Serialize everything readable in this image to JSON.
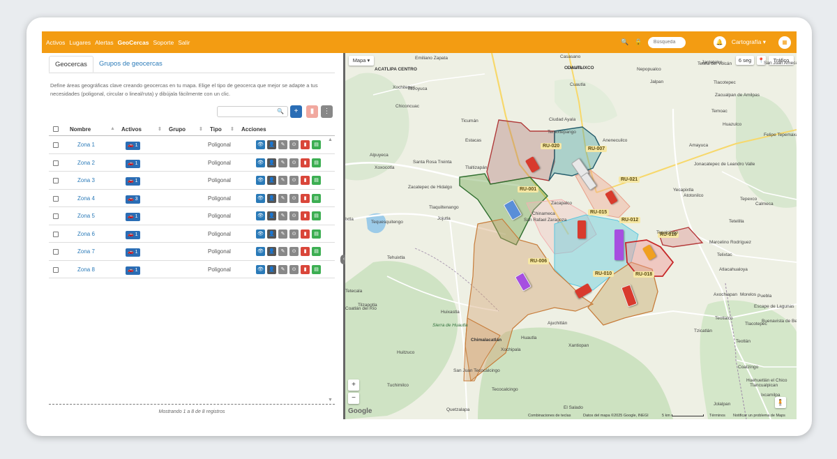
{
  "nav": [
    "Activos",
    "Lugares",
    "Alertas",
    "GeoCercas",
    "Soporte",
    "Salir"
  ],
  "topbar": {
    "search_placeholder": "Búsqueda",
    "user": "Cartografía",
    "user_caret": "▾",
    "search_icon": "🔍",
    "lock_icon": "🔒",
    "bell_icon": "🔔",
    "grid_icon": "▦"
  },
  "tabs": [
    "Geocercas",
    "Grupos de geocercas"
  ],
  "description": "Define áreas geográficas clave creando geocercas en tu mapa. Elige el tipo de geocerca que mejor se adapte a tus necesidades (poligonal, circular o lineal/ruta) y dibújala fácilmente con un clic.",
  "table": {
    "headers": [
      "Nombre",
      "Activos",
      "Grupo",
      "Tipo",
      "Acciones"
    ],
    "rows": [
      {
        "name": "Zona 1",
        "active": "1",
        "type": "Poligonal"
      },
      {
        "name": "Zona 2",
        "active": "1",
        "type": "Poligonal"
      },
      {
        "name": "Zona 3",
        "active": "1",
        "type": "Poligonal"
      },
      {
        "name": "Zona 4",
        "active": "3",
        "type": "Poligonal"
      },
      {
        "name": "Zona 5",
        "active": "1",
        "type": "Poligonal"
      },
      {
        "name": "Zona 6",
        "active": "1",
        "type": "Poligonal"
      },
      {
        "name": "Zona 7",
        "active": "1",
        "type": "Poligonal"
      },
      {
        "name": "Zona 8",
        "active": "1",
        "type": "Poligonal"
      }
    ],
    "footer": "Mostrando 1 a 8 de 8 registros"
  },
  "map": {
    "type_button": "Mapa ▾",
    "refresh": "6 seg",
    "traffic": "Tráfico",
    "pin_icon": "📍",
    "zoom_in": "+",
    "zoom_out": "−",
    "pegman_icon": "🧍",
    "google": "Google",
    "attribution": [
      "Combinaciones de teclas",
      "Datos del mapa ©2025 Google, INEGI",
      "5 km",
      "Términos",
      "Notificar un problema de Maps"
    ],
    "route_tags": [
      "RU-020",
      "RU-007",
      "RU-001",
      "RU-021",
      "RU-015",
      "RU-012",
      "RU-019",
      "RU-006",
      "RU-010",
      "RU-018"
    ],
    "places": [
      "Emiliano Zapata",
      "ACATLIPA CENTRO",
      "Xochitepec",
      "Tezoyuca",
      "Chiconcuac",
      "Casasano",
      "CUAUTLIXCO",
      "Cuautla",
      "Ciudad Ayala",
      "Tenextepango",
      "Anenecuilco",
      "Tlacotepec",
      "Zacualpan de Amilpas",
      "Temoac",
      "Huazulco",
      "Amayuca",
      "Tetela del Volcán",
      "Jantetelco",
      "Jonacatepec de Leandro Valle",
      "Atotonilco",
      "Tepexco",
      "Calmeca",
      "Tetelilla",
      "Tepalcingo",
      "Marcelino Rodríguez",
      "Telixtac",
      "Atlacahualoya",
      "Axochiapan",
      "Teotlalco",
      "Tzicatlán",
      "Tlacotepec",
      "Escape de Lagunas",
      "Buenavista de Benito Juárez",
      "Huehuetlán el Chico",
      "Ixcamilpa",
      "Tlancualpican",
      "Jolalpan",
      "Tehuixtla",
      "Huitzuco",
      "Tetecala",
      "Coatlán del Río",
      "Xoxocotla",
      "Alpuyeca",
      "Tlaltizapán",
      "Santa Rosa Treinta",
      "Zacatepec de Hidalgo",
      "Tlaquiltenango",
      "Jojutla",
      "Tequesquitengo",
      "Ixtla",
      "San Rafael Zaragoza",
      "Chinameca",
      "Zacapalco",
      "Ticumán",
      "Estacas",
      "Yecapixtla",
      "Felipe Tepemaxalco",
      "San Juan Amecac",
      "Nepopualco",
      "Jalpan",
      "Tilzapotla",
      "Huixastla",
      "Sierra de Huautla",
      "Chimalacatlán",
      "Huautla",
      "Xochipala",
      "Ajuchitlán",
      "Xantiopan",
      "San Juan Tecocalcingo",
      "Tecocalcingo",
      "Tuchimilco",
      "Quetzalapa",
      "El Salado",
      "Coatzingo",
      "Teotlán",
      "Puebla",
      "Morelos",
      "Cuautla"
    ]
  },
  "colors": {
    "primary": "#f39c12",
    "blue": "#2a6db5",
    "link": "#2a7ab8"
  }
}
